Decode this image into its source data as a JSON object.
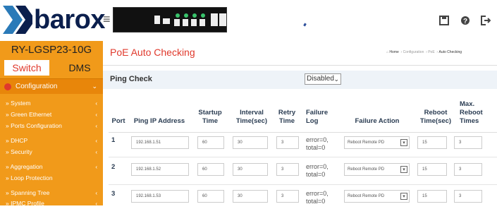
{
  "header": {
    "brand": "barox",
    "hamburger": "≡",
    "icons": [
      "save-icon",
      "help-icon",
      "logout-icon"
    ]
  },
  "sidebar": {
    "model": "RY-LGSP23-10G",
    "tabs": [
      {
        "label": "Switch",
        "active": true
      },
      {
        "label": "DMS",
        "active": false
      }
    ],
    "section": "Configuration",
    "items": [
      {
        "label": "» System"
      },
      {
        "label": "» Green Ethernet"
      },
      {
        "label": "» Ports Configuration"
      },
      {
        "label": "» DHCP"
      },
      {
        "label": "» Security"
      },
      {
        "label": "» Aggregation"
      },
      {
        "label": "» Loop Protection"
      },
      {
        "label": "» Spanning Tree"
      },
      {
        "label": "» IPMC Profile"
      }
    ]
  },
  "page": {
    "title": "PoE Auto Checking",
    "breadcrumb": {
      "home": "Home",
      "path": [
        "Configuration",
        "PoE",
        "Auto Checking"
      ]
    }
  },
  "ping_check": {
    "label": "Ping Check",
    "value": "Disabled"
  },
  "table": {
    "headers": {
      "port": "Port",
      "ping_ip": "Ping IP Address",
      "startup_1": "Startup",
      "startup_2": "Time",
      "interval_1": "Interval",
      "interval_2": "Time(sec)",
      "retry_1": "Retry",
      "retry_2": "Time",
      "failure_log_1": "Failure",
      "failure_log_2": "Log",
      "failure_action": "Failure Action",
      "reboot_1": "Reboot",
      "reboot_2": "Time(sec)",
      "max_1": "Max.",
      "max_2": "Reboot",
      "max_3": "Times"
    },
    "rows": [
      {
        "port": "1",
        "ip": "192.168.1.51",
        "startup": "60",
        "interval": "30",
        "retry": "3",
        "log_1": "error=0,",
        "log_2": "total=0",
        "action": "Reboot Remote PD",
        "reboot": "15",
        "max": "3"
      },
      {
        "port": "2",
        "ip": "192.168.1.52",
        "startup": "60",
        "interval": "30",
        "retry": "3",
        "log_1": "error=0,",
        "log_2": "total=0",
        "action": "Reboot Remote PD",
        "reboot": "15",
        "max": "3"
      },
      {
        "port": "3",
        "ip": "192.168.1.53",
        "startup": "60",
        "interval": "30",
        "retry": "3",
        "log_1": "error=0,",
        "log_2": "total=0",
        "action": "Reboot Remote PD",
        "reboot": "15",
        "max": "3"
      }
    ]
  },
  "colors": {
    "sidebar_bg": "#f19a1a",
    "accent_red": "#e0392c",
    "brand_navy": "#0b1f4d",
    "link_blue": "#2a7ab8"
  }
}
